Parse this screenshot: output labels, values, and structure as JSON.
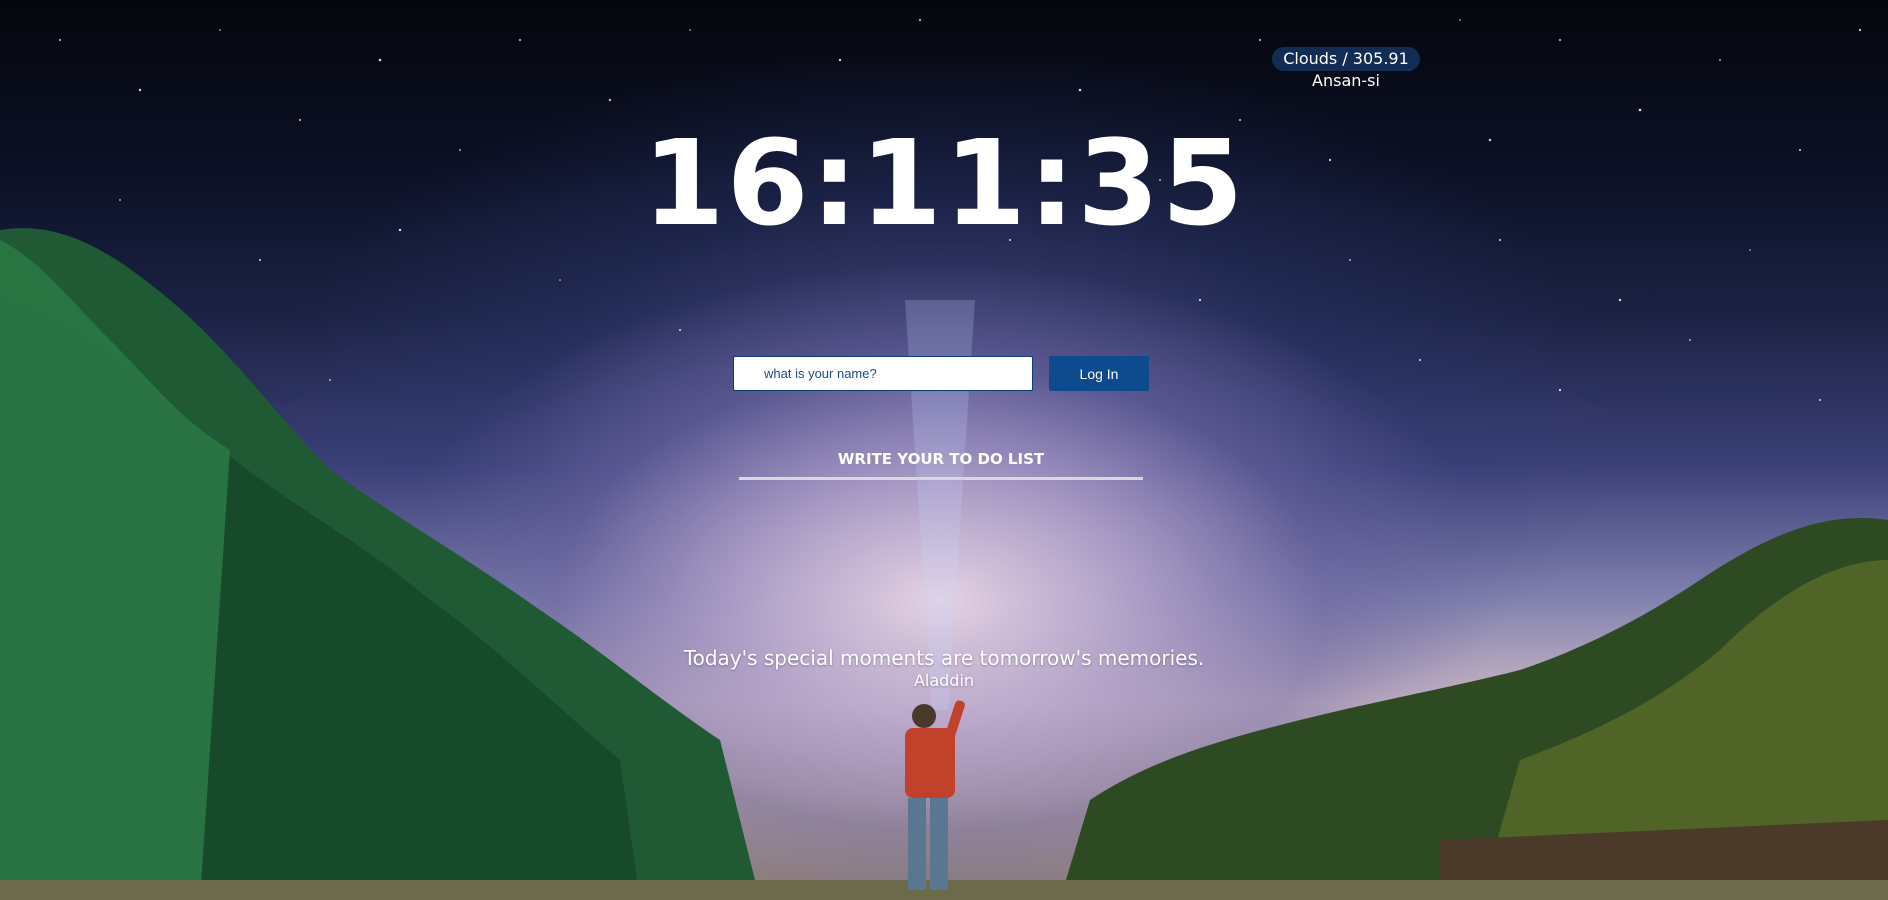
{
  "weather": {
    "summary": "Clouds / 305.91",
    "city": "Ansan-si"
  },
  "clock": {
    "time": "16:11:35"
  },
  "login": {
    "name_placeholder": "what is your name?",
    "button_label": "Log In"
  },
  "todo": {
    "label": "WRITE YOUR TO DO LIST"
  },
  "quote": {
    "text": "Today's special moments are tomorrow's memories.",
    "author": "Aladdin"
  }
}
